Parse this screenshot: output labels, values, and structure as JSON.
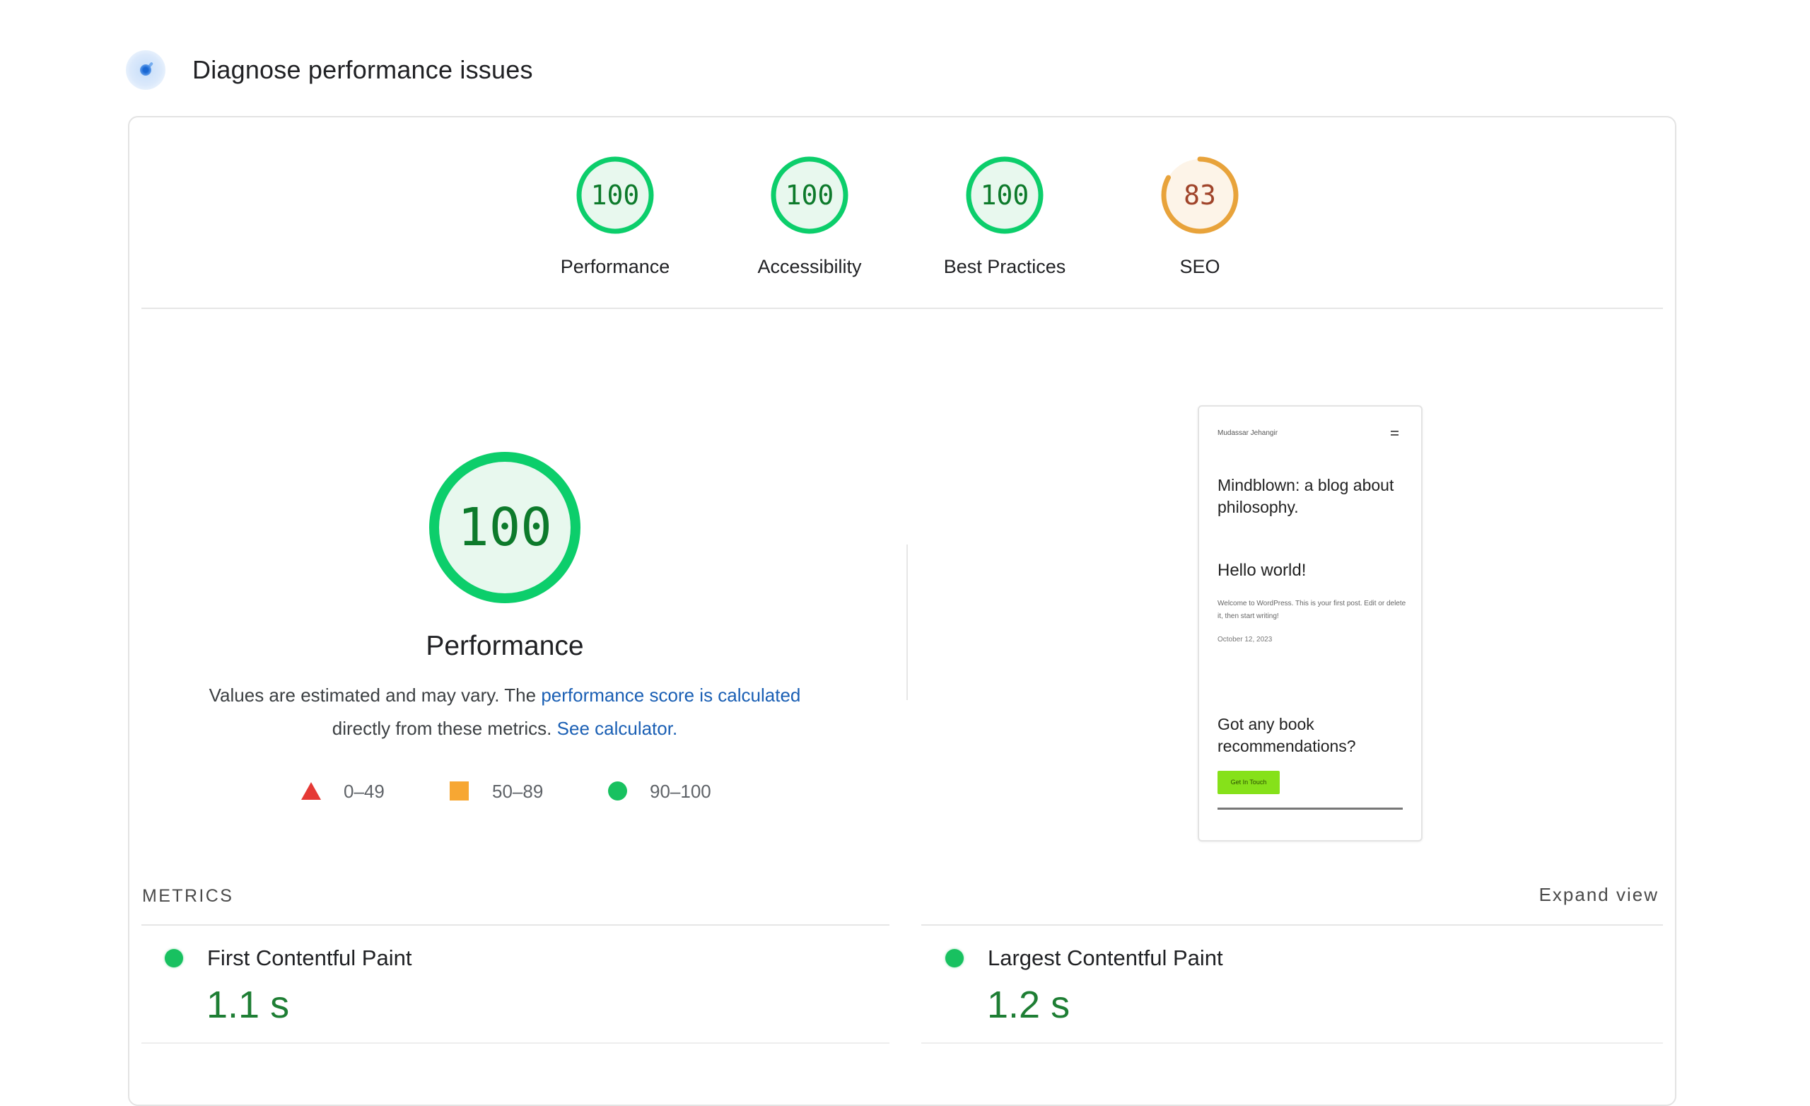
{
  "header": {
    "icon": "lighthouse-gauge-icon",
    "title": "Diagnose performance issues"
  },
  "categories": [
    {
      "label": "Performance",
      "score": 100,
      "rating": "pass",
      "color": "#0cce6b",
      "text_color": "#0d7a2b",
      "fill": "#e8f8ee"
    },
    {
      "label": "Accessibility",
      "score": 100,
      "rating": "pass",
      "color": "#0cce6b",
      "text_color": "#0d7a2b",
      "fill": "#e8f8ee"
    },
    {
      "label": "Best Practices",
      "score": 100,
      "rating": "pass",
      "color": "#0cce6b",
      "text_color": "#0d7a2b",
      "fill": "#e8f8ee"
    },
    {
      "label": "SEO",
      "score": 83,
      "rating": "average",
      "color": "#e8a33b",
      "text_color": "#a0442a",
      "fill": "#fdf4e8"
    }
  ],
  "performance": {
    "score": 100,
    "title": "Performance",
    "description_prefix": "Values are estimated and may vary. The ",
    "description_link": "performance score is calculated",
    "description_middle": "directly from these metrics. ",
    "calculator_link": "See calculator.",
    "legend": [
      {
        "shape": "triangle",
        "range": "0–49",
        "color": "#e53935"
      },
      {
        "shape": "square",
        "range": "50–89",
        "color": "#f7a733"
      },
      {
        "shape": "circle",
        "range": "90–100",
        "color": "#18c160"
      }
    ]
  },
  "screenshot": {
    "site_name": "Mudassar Jehangir",
    "menu_icon": "hamburger-menu-icon",
    "heading": "Mindblown: a blog about philosophy.",
    "post_title": "Hello world!",
    "post_excerpt": "Welcome to WordPress. This is your first post. Edit or delete it, then start writing!",
    "post_date": "October 12, 2023",
    "cta_heading": "Got any book recommendations?",
    "cta_button": "Get In Touch",
    "cta_button_color": "#86e11a"
  },
  "metrics": {
    "section_label": "METRICS",
    "expand_label": "Expand view",
    "items": [
      {
        "name": "First Contentful Paint",
        "value": "1.1 s",
        "rating": "pass"
      },
      {
        "name": "Largest Contentful Paint",
        "value": "1.2 s",
        "rating": "pass"
      }
    ]
  }
}
